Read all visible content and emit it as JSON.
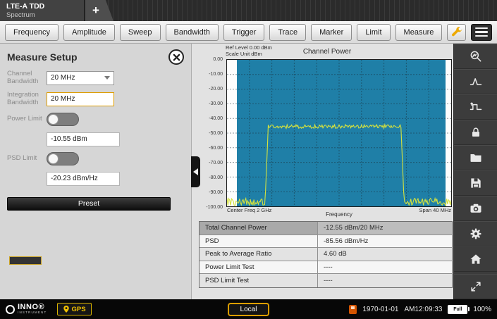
{
  "window": {
    "title_line1": "LTE-A TDD",
    "title_line2": "Spectrum",
    "new_tab": "+"
  },
  "toolbar": {
    "buttons": [
      "Frequency",
      "Amplitude",
      "Sweep",
      "Bandwidth",
      "Trigger",
      "Trace",
      "Marker",
      "Limit",
      "Measure"
    ],
    "icons": [
      "wrench-icon",
      "hamburger-menu-icon"
    ]
  },
  "measure_setup": {
    "title": "Measure Setup",
    "channel_bandwidth_label": "Channel Bandwidth",
    "channel_bandwidth_value": "20 MHz",
    "integration_bandwidth_label": "Integration Bandwidth",
    "integration_bandwidth_value": "20 MHz",
    "power_limit_label": "Power Limit",
    "power_limit_state": "off",
    "power_limit_value": "-10.55 dBm",
    "psd_limit_label": "PSD Limit",
    "psd_limit_state": "off",
    "psd_limit_value": "-20.23 dBm/Hz",
    "preset_label": "Preset"
  },
  "chart": {
    "ref_level_label": "Ref Level 0.00 dBm",
    "scale_unit_label": "Scale Unit  dBm",
    "title": "Channel Power",
    "center_freq_label": "Center Freq 2 GHz",
    "x_axis_label": "Frequency",
    "span_label": "Span 40 MHz"
  },
  "chart_data": {
    "type": "line",
    "title": "Channel Power",
    "ylabel": "dBm",
    "ylim": [
      -100,
      0
    ],
    "y_ticks": [
      "0.00",
      "-10.00",
      "-20.00",
      "-30.00",
      "-40.00",
      "-50.00",
      "-60.00",
      "-70.00",
      "-80.00",
      "-90.00",
      "-100.00"
    ],
    "ref_level_dbm": 0.0,
    "scale_unit": "dBm",
    "center_freq": "2 GHz",
    "span": "40 MHz",
    "grid": true,
    "channel_band": {
      "start_frac": 0.045,
      "end_frac": 0.975,
      "color": "#1f7fa7"
    },
    "series": [
      {
        "name": "spectrum-trace",
        "color": "#d5e23e",
        "noise_floor_dbm": -97,
        "plateau_dbm": -45.5,
        "plateau_start_frac": 0.17,
        "plateau_end_frac": 0.79,
        "noise_pp_db": 5,
        "ripple_pp_db": 2.6
      }
    ]
  },
  "results_table": {
    "rows": [
      {
        "label": "Total Channel Power",
        "value": "-12.55 dBm/20 MHz"
      },
      {
        "label": "PSD",
        "value": "-85.56 dBm/Hz"
      },
      {
        "label": "Peak to Average Ratio",
        "value": "4.60 dB"
      },
      {
        "label": "Power Limit Test",
        "value": "----"
      },
      {
        "label": "PSD Limit Test",
        "value": "----"
      }
    ]
  },
  "rail": {
    "icons": [
      "peak-search",
      "trace-peak",
      "limit-line",
      "lock",
      "folder",
      "save",
      "screenshot",
      "settings",
      "home",
      "fullscreen"
    ]
  },
  "status_bar": {
    "brand": "INNO®",
    "brand_sub": "INSTRUMENT",
    "gps_label": "GPS",
    "local_label": "Local",
    "date": "1970-01-01",
    "time": "AM12:09:33",
    "battery_label": "Full",
    "battery_percent": "100%",
    "icons": [
      "usb-icon",
      "battery-icon",
      "gps-pin-icon"
    ]
  }
}
